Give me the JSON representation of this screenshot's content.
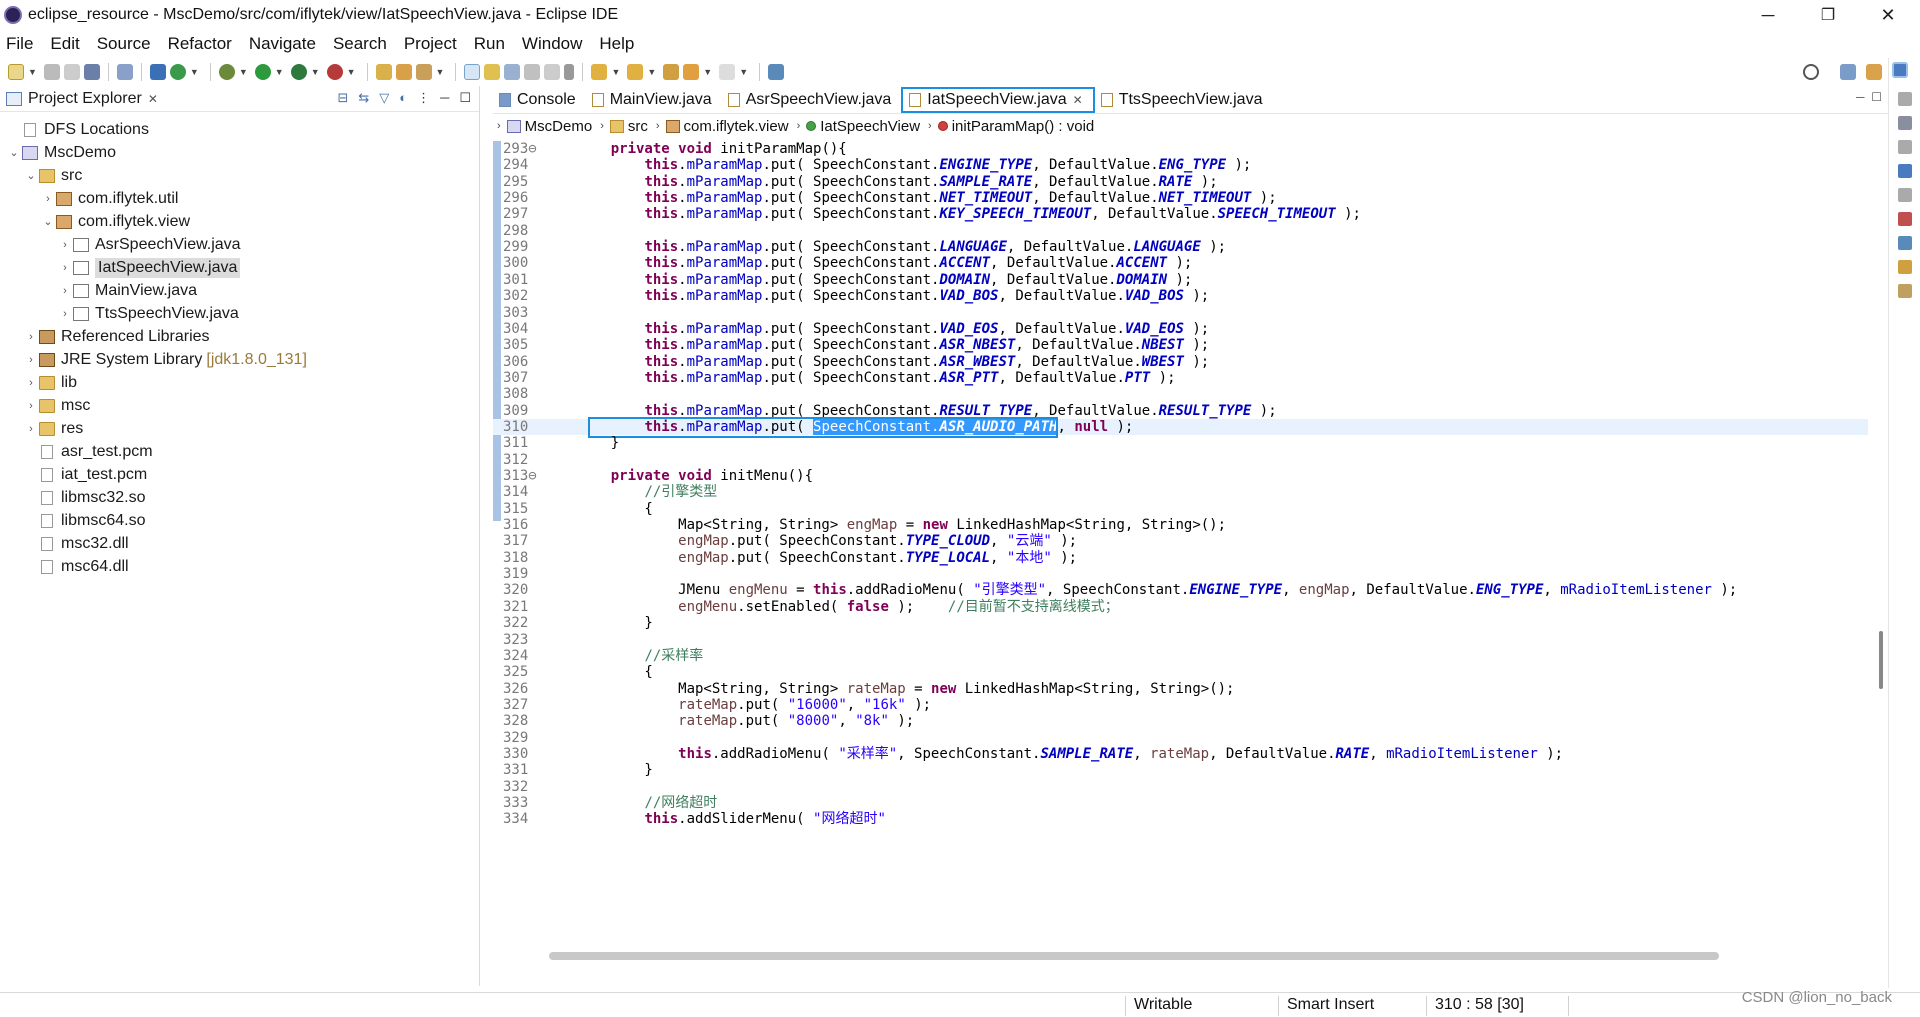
{
  "window": {
    "title": "eclipse_resource - MscDemo/src/com/iflytek/view/IatSpeechView.java - Eclipse IDE",
    "controls": {
      "minimize": "─",
      "restore": "❐",
      "close": "✕"
    }
  },
  "menu": [
    "File",
    "Edit",
    "Source",
    "Refactor",
    "Navigate",
    "Search",
    "Project",
    "Run",
    "Window",
    "Help"
  ],
  "project_explorer": {
    "title": "Project Explorer",
    "tree": [
      {
        "label": "DFS Locations",
        "icon": "dfs-icon",
        "level": 0,
        "twisty": ""
      },
      {
        "label": "MscDemo",
        "icon": "project-icon",
        "level": 0,
        "twisty": "⌄"
      },
      {
        "label": "src",
        "icon": "source-folder-icon",
        "level": 1,
        "twisty": "⌄"
      },
      {
        "label": "com.iflytek.util",
        "icon": "package-icon",
        "level": 2,
        "twisty": "›"
      },
      {
        "label": "com.iflytek.view",
        "icon": "package-icon",
        "level": 2,
        "twisty": "⌄"
      },
      {
        "label": "AsrSpeechView.java",
        "icon": "java-file-icon",
        "level": 3,
        "twisty": "›"
      },
      {
        "label": "IatSpeechView.java",
        "icon": "java-file-icon",
        "level": 3,
        "twisty": "›",
        "selected": true
      },
      {
        "label": "MainView.java",
        "icon": "java-file-icon",
        "level": 3,
        "twisty": "›"
      },
      {
        "label": "TtsSpeechView.java",
        "icon": "java-file-icon",
        "level": 3,
        "twisty": "›"
      },
      {
        "label": "Referenced Libraries",
        "icon": "library-icon",
        "level": 1,
        "twisty": "›"
      },
      {
        "label": "JRE System Library",
        "suffix": "[jdk1.8.0_131]",
        "icon": "library-icon",
        "level": 1,
        "twisty": "›"
      },
      {
        "label": "lib",
        "icon": "folder-icon",
        "level": 1,
        "twisty": "›"
      },
      {
        "label": "msc",
        "icon": "folder-icon",
        "level": 1,
        "twisty": "›"
      },
      {
        "label": "res",
        "icon": "folder-icon",
        "level": 1,
        "twisty": "›"
      },
      {
        "label": "asr_test.pcm",
        "icon": "file-icon",
        "level": 1,
        "twisty": ""
      },
      {
        "label": "iat_test.pcm",
        "icon": "file-icon",
        "level": 1,
        "twisty": ""
      },
      {
        "label": "libmsc32.so",
        "icon": "file-icon",
        "level": 1,
        "twisty": ""
      },
      {
        "label": "libmsc64.so",
        "icon": "file-icon",
        "level": 1,
        "twisty": ""
      },
      {
        "label": "msc32.dll",
        "icon": "file-icon",
        "level": 1,
        "twisty": ""
      },
      {
        "label": "msc64.dll",
        "icon": "file-icon",
        "level": 1,
        "twisty": ""
      }
    ]
  },
  "editor_tabs": [
    {
      "label": "Console",
      "active": false
    },
    {
      "label": "MainView.java",
      "active": false
    },
    {
      "label": "AsrSpeechView.java",
      "active": false
    },
    {
      "label": "IatSpeechView.java",
      "active": true
    },
    {
      "label": "TtsSpeechView.java",
      "active": false
    }
  ],
  "breadcrumb": [
    "MscDemo",
    "src",
    "com.iflytek.view",
    "IatSpeechView",
    "initParamMap() : void"
  ],
  "code": [
    {
      "n": "293⊖",
      "t": [
        [
          "",
          "    "
        ],
        [
          "kw",
          "private void"
        ],
        [
          "",
          " initParamMap(){"
        ]
      ]
    },
    {
      "n": "294",
      "t": [
        [
          "",
          "        "
        ],
        [
          "kw",
          "this"
        ],
        [
          "",
          "."
        ],
        [
          "fld",
          "mParamMap"
        ],
        [
          "",
          ".put( SpeechConstant."
        ],
        [
          "sf",
          "ENGINE_TYPE"
        ],
        [
          "",
          ", DefaultValue."
        ],
        [
          "sf",
          "ENG_TYPE"
        ],
        [
          "",
          " );"
        ]
      ]
    },
    {
      "n": "295",
      "t": [
        [
          "",
          "        "
        ],
        [
          "kw",
          "this"
        ],
        [
          "",
          "."
        ],
        [
          "fld",
          "mParamMap"
        ],
        [
          "",
          ".put( SpeechConstant."
        ],
        [
          "sf",
          "SAMPLE_RATE"
        ],
        [
          "",
          ", DefaultValue."
        ],
        [
          "sf",
          "RATE"
        ],
        [
          "",
          " );"
        ]
      ]
    },
    {
      "n": "296",
      "t": [
        [
          "",
          "        "
        ],
        [
          "kw",
          "this"
        ],
        [
          "",
          "."
        ],
        [
          "fld",
          "mParamMap"
        ],
        [
          "",
          ".put( SpeechConstant."
        ],
        [
          "sf",
          "NET_TIMEOUT"
        ],
        [
          "",
          ", DefaultValue."
        ],
        [
          "sf",
          "NET_TIMEOUT"
        ],
        [
          "",
          " );"
        ]
      ]
    },
    {
      "n": "297",
      "t": [
        [
          "",
          "        "
        ],
        [
          "kw",
          "this"
        ],
        [
          "",
          "."
        ],
        [
          "fld",
          "mParamMap"
        ],
        [
          "",
          ".put( SpeechConstant."
        ],
        [
          "sf",
          "KEY_SPEECH_TIMEOUT"
        ],
        [
          "",
          ", DefaultValue."
        ],
        [
          "sf",
          "SPEECH_TIMEOUT"
        ],
        [
          "",
          " );"
        ]
      ]
    },
    {
      "n": "298",
      "t": []
    },
    {
      "n": "299",
      "t": [
        [
          "",
          "        "
        ],
        [
          "kw",
          "this"
        ],
        [
          "",
          "."
        ],
        [
          "fld",
          "mParamMap"
        ],
        [
          "",
          ".put( SpeechConstant."
        ],
        [
          "sf",
          "LANGUAGE"
        ],
        [
          "",
          ", DefaultValue."
        ],
        [
          "sf",
          "LANGUAGE"
        ],
        [
          "",
          " );"
        ]
      ]
    },
    {
      "n": "300",
      "t": [
        [
          "",
          "        "
        ],
        [
          "kw",
          "this"
        ],
        [
          "",
          "."
        ],
        [
          "fld",
          "mParamMap"
        ],
        [
          "",
          ".put( SpeechConstant."
        ],
        [
          "sf",
          "ACCENT"
        ],
        [
          "",
          ", DefaultValue."
        ],
        [
          "sf",
          "ACCENT"
        ],
        [
          "",
          " );"
        ]
      ]
    },
    {
      "n": "301",
      "t": [
        [
          "",
          "        "
        ],
        [
          "kw",
          "this"
        ],
        [
          "",
          "."
        ],
        [
          "fld",
          "mParamMap"
        ],
        [
          "",
          ".put( SpeechConstant."
        ],
        [
          "sf",
          "DOMAIN"
        ],
        [
          "",
          ", DefaultValue."
        ],
        [
          "sf",
          "DOMAIN"
        ],
        [
          "",
          " );"
        ]
      ]
    },
    {
      "n": "302",
      "t": [
        [
          "",
          "        "
        ],
        [
          "kw",
          "this"
        ],
        [
          "",
          "."
        ],
        [
          "fld",
          "mParamMap"
        ],
        [
          "",
          ".put( SpeechConstant."
        ],
        [
          "sf",
          "VAD_BOS"
        ],
        [
          "",
          ", DefaultValue."
        ],
        [
          "sf",
          "VAD_BOS"
        ],
        [
          "",
          " );"
        ]
      ]
    },
    {
      "n": "303",
      "t": []
    },
    {
      "n": "304",
      "t": [
        [
          "",
          "        "
        ],
        [
          "kw",
          "this"
        ],
        [
          "",
          "."
        ],
        [
          "fld",
          "mParamMap"
        ],
        [
          "",
          ".put( SpeechConstant."
        ],
        [
          "sf",
          "VAD_EOS"
        ],
        [
          "",
          ", DefaultValue."
        ],
        [
          "sf",
          "VAD_EOS"
        ],
        [
          "",
          " );"
        ]
      ]
    },
    {
      "n": "305",
      "t": [
        [
          "",
          "        "
        ],
        [
          "kw",
          "this"
        ],
        [
          "",
          "."
        ],
        [
          "fld",
          "mParamMap"
        ],
        [
          "",
          ".put( SpeechConstant."
        ],
        [
          "sf",
          "ASR_NBEST"
        ],
        [
          "",
          ", DefaultValue."
        ],
        [
          "sf",
          "NBEST"
        ],
        [
          "",
          " );"
        ]
      ]
    },
    {
      "n": "306",
      "t": [
        [
          "",
          "        "
        ],
        [
          "kw",
          "this"
        ],
        [
          "",
          "."
        ],
        [
          "fld",
          "mParamMap"
        ],
        [
          "",
          ".put( SpeechConstant."
        ],
        [
          "sf",
          "ASR_WBEST"
        ],
        [
          "",
          ", DefaultValue."
        ],
        [
          "sf",
          "WBEST"
        ],
        [
          "",
          " );"
        ]
      ]
    },
    {
      "n": "307",
      "t": [
        [
          "",
          "        "
        ],
        [
          "kw",
          "this"
        ],
        [
          "",
          "."
        ],
        [
          "fld",
          "mParamMap"
        ],
        [
          "",
          ".put( SpeechConstant."
        ],
        [
          "sf",
          "ASR_PTT"
        ],
        [
          "",
          ", DefaultValue."
        ],
        [
          "sf",
          "PTT"
        ],
        [
          "",
          " );"
        ]
      ]
    },
    {
      "n": "308",
      "t": []
    },
    {
      "n": "309",
      "t": [
        [
          "",
          "        "
        ],
        [
          "kw",
          "this"
        ],
        [
          "",
          "."
        ],
        [
          "fld",
          "mParamMap"
        ],
        [
          "",
          ".put( SpeechConstant."
        ],
        [
          "sf",
          "RESULT_TYPE"
        ],
        [
          "",
          ", DefaultValue."
        ],
        [
          "sf",
          "RESULT_TYPE"
        ],
        [
          "",
          " );"
        ]
      ]
    },
    {
      "n": "310",
      "cur": true,
      "t": [
        [
          "",
          "        "
        ],
        [
          "kw",
          "this"
        ],
        [
          "",
          "."
        ],
        [
          "fld",
          "mParamMap"
        ],
        [
          "",
          ".put( "
        ],
        [
          "hl",
          "SpeechConstant."
        ],
        [
          "hlsf",
          "ASR_AUDIO_PATH"
        ],
        [
          "",
          ", "
        ],
        [
          "kw",
          "null"
        ],
        [
          "",
          " );"
        ]
      ]
    },
    {
      "n": "311",
      "t": [
        [
          "",
          "    }"
        ]
      ]
    },
    {
      "n": "312",
      "t": []
    },
    {
      "n": "313⊖",
      "t": [
        [
          "",
          "    "
        ],
        [
          "kw",
          "private void"
        ],
        [
          "",
          " initMenu(){"
        ]
      ]
    },
    {
      "n": "314",
      "t": [
        [
          "",
          "        "
        ],
        [
          "cmt",
          "//引擎类型"
        ]
      ]
    },
    {
      "n": "315",
      "t": [
        [
          "",
          "        {"
        ]
      ]
    },
    {
      "n": "316",
      "t": [
        [
          "",
          "            Map<String, String> "
        ],
        [
          "lv",
          "engMap"
        ],
        [
          "",
          " = "
        ],
        [
          "kw",
          "new"
        ],
        [
          "",
          " LinkedHashMap<String, String>();"
        ]
      ]
    },
    {
      "n": "317",
      "t": [
        [
          "",
          "            "
        ],
        [
          "lv",
          "engMap"
        ],
        [
          "",
          ".put( SpeechConstant."
        ],
        [
          "sf",
          "TYPE_CLOUD"
        ],
        [
          "",
          ", "
        ],
        [
          "str",
          "\"云端\""
        ],
        [
          "",
          " );"
        ]
      ]
    },
    {
      "n": "318",
      "t": [
        [
          "",
          "            "
        ],
        [
          "lv",
          "engMap"
        ],
        [
          "",
          ".put( SpeechConstant."
        ],
        [
          "sf",
          "TYPE_LOCAL"
        ],
        [
          "",
          ", "
        ],
        [
          "str",
          "\"本地\""
        ],
        [
          "",
          " );"
        ]
      ]
    },
    {
      "n": "319",
      "t": []
    },
    {
      "n": "320",
      "t": [
        [
          "",
          "            JMenu "
        ],
        [
          "lv",
          "engMenu"
        ],
        [
          "",
          " = "
        ],
        [
          "kw",
          "this"
        ],
        [
          "",
          ".addRadioMenu( "
        ],
        [
          "str",
          "\"引擎类型\""
        ],
        [
          "",
          ", SpeechConstant."
        ],
        [
          "sf",
          "ENGINE_TYPE"
        ],
        [
          "",
          ", "
        ],
        [
          "lv",
          "engMap"
        ],
        [
          "",
          ", DefaultValue."
        ],
        [
          "sf",
          "ENG_TYPE"
        ],
        [
          "",
          ", "
        ],
        [
          "fld",
          "mRadioItemListener"
        ],
        [
          "",
          " );"
        ]
      ]
    },
    {
      "n": "321",
      "t": [
        [
          "",
          "            "
        ],
        [
          "lv",
          "engMenu"
        ],
        [
          "",
          ".setEnabled( "
        ],
        [
          "kw",
          "false"
        ],
        [
          "",
          " );    "
        ],
        [
          "cmt",
          "//目前暂不支持离线模式；"
        ]
      ]
    },
    {
      "n": "322",
      "t": [
        [
          "",
          "        }"
        ]
      ]
    },
    {
      "n": "323",
      "t": []
    },
    {
      "n": "324",
      "t": [
        [
          "",
          "        "
        ],
        [
          "cmt",
          "//采样率"
        ]
      ]
    },
    {
      "n": "325",
      "t": [
        [
          "",
          "        {"
        ]
      ]
    },
    {
      "n": "326",
      "t": [
        [
          "",
          "            Map<String, String> "
        ],
        [
          "lv",
          "rateMap"
        ],
        [
          "",
          " = "
        ],
        [
          "kw",
          "new"
        ],
        [
          "",
          " LinkedHashMap<String, String>();"
        ]
      ]
    },
    {
      "n": "327",
      "t": [
        [
          "",
          "            "
        ],
        [
          "lv",
          "rateMap"
        ],
        [
          "",
          ".put( "
        ],
        [
          "str",
          "\"16000\""
        ],
        [
          "",
          ", "
        ],
        [
          "str",
          "\"16k\""
        ],
        [
          "",
          " );"
        ]
      ]
    },
    {
      "n": "328",
      "t": [
        [
          "",
          "            "
        ],
        [
          "lv",
          "rateMap"
        ],
        [
          "",
          ".put( "
        ],
        [
          "str",
          "\"8000\""
        ],
        [
          "",
          ", "
        ],
        [
          "str",
          "\"8k\""
        ],
        [
          "",
          " );"
        ]
      ]
    },
    {
      "n": "329",
      "t": []
    },
    {
      "n": "330",
      "t": [
        [
          "",
          "            "
        ],
        [
          "kw",
          "this"
        ],
        [
          "",
          ".addRadioMenu( "
        ],
        [
          "str",
          "\"采样率\""
        ],
        [
          "",
          ", SpeechConstant."
        ],
        [
          "sf",
          "SAMPLE_RATE"
        ],
        [
          "",
          ", "
        ],
        [
          "lv",
          "rateMap"
        ],
        [
          "",
          ", DefaultValue."
        ],
        [
          "sf",
          "RATE"
        ],
        [
          "",
          ", "
        ],
        [
          "fld",
          "mRadioItemListener"
        ],
        [
          "",
          " );"
        ]
      ]
    },
    {
      "n": "331",
      "t": [
        [
          "",
          "        }"
        ]
      ]
    },
    {
      "n": "332",
      "t": []
    },
    {
      "n": "333",
      "t": [
        [
          "",
          "        "
        ],
        [
          "cmt",
          "//网络超时"
        ]
      ]
    },
    {
      "n": "334",
      "t": [
        [
          "",
          "        "
        ],
        [
          "kw",
          "this"
        ],
        [
          "",
          ".addSliderMenu( "
        ],
        [
          "str",
          "\"网络超时\""
        ]
      ]
    }
  ],
  "status": {
    "writable": "Writable",
    "insert_mode": "Smart Insert",
    "position": "310 : 58 [30]"
  },
  "watermark": "CSDN @lion_no_back",
  "colors": {
    "accent": "#1d8de0",
    "selection": "#3399ff",
    "keyword": "#7f0055",
    "field": "#0000c0",
    "string": "#2a00ff",
    "comment": "#3f7f5f"
  }
}
